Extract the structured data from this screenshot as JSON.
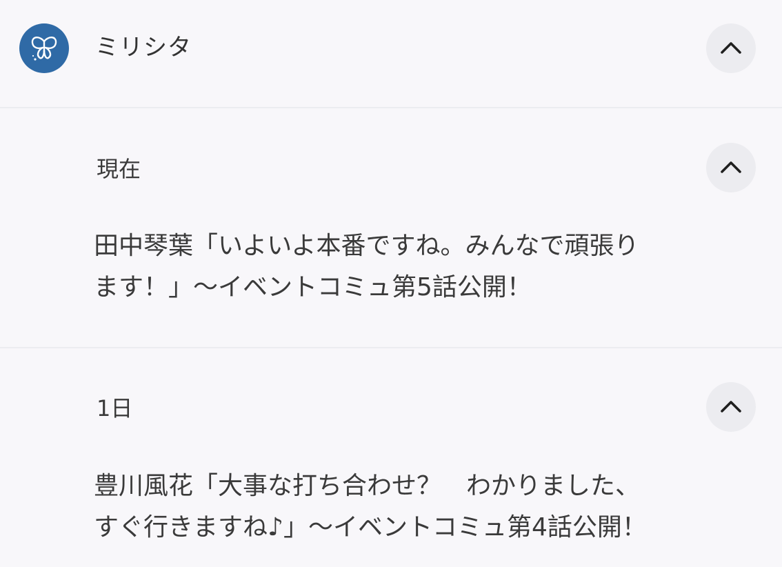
{
  "app": {
    "name": "ミリシタ",
    "icon": "butterfly-icon",
    "icon_color": "#2f6aa6"
  },
  "header": {
    "collapse_icon": "chevron-up-icon"
  },
  "notifications": [
    {
      "time": "現在",
      "text": "田中琴葉「いよいよ本番ですね。みんなで頑張り\nます！」〜イベントコミュ第5話公開！",
      "collapse_icon": "chevron-up-icon"
    },
    {
      "time": "1日",
      "text": "豊川風花「大事な打ち合わせ？　わかりました、\nすぐ行きますね♪」〜イベントコミュ第4話公開！",
      "collapse_icon": "chevron-up-icon"
    }
  ],
  "colors": {
    "background": "#f8f7fa",
    "divider": "#ececf0",
    "button_bg": "#ececf0",
    "text": "#333333"
  }
}
